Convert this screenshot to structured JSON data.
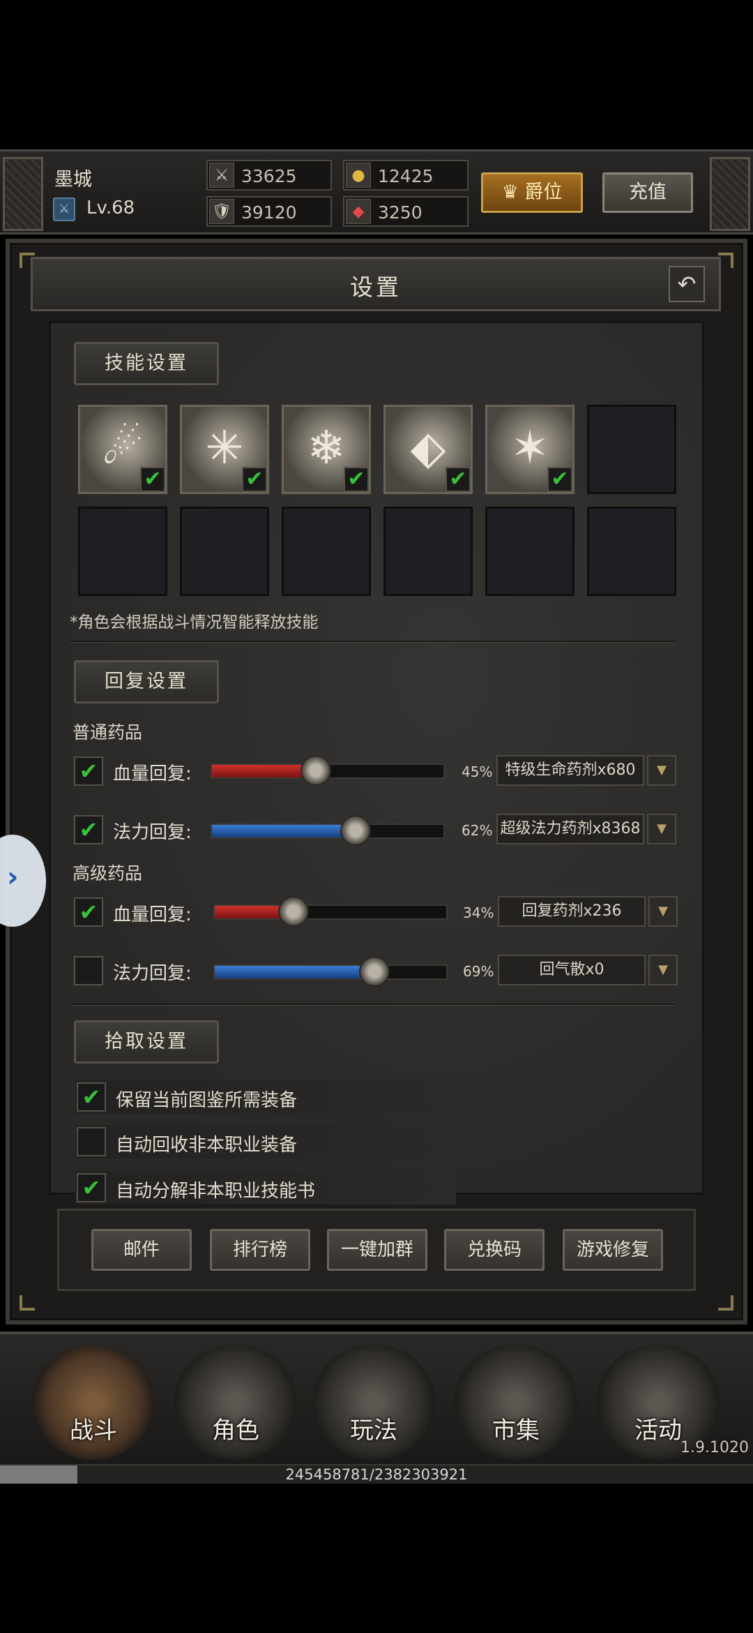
{
  "player": {
    "name": "墨城",
    "level": "Lv.68"
  },
  "stats": {
    "attack": "33625",
    "defense": "39120",
    "gold": "12425",
    "gems": "3250"
  },
  "header_buttons": {
    "rank_label": "爵位",
    "recharge_label": "充值"
  },
  "settings": {
    "title": "设置",
    "skill_section": {
      "label": "技能设置",
      "slots": [
        {
          "icon": "fireball-icon",
          "checked": true
        },
        {
          "icon": "burst-icon",
          "checked": true
        },
        {
          "icon": "frost-shield-icon",
          "checked": true
        },
        {
          "icon": "ice-shard-icon",
          "checked": true
        },
        {
          "icon": "meteor-shower-icon",
          "checked": true
        },
        {
          "icon": "empty-slot",
          "checked": false
        }
      ],
      "note": "*角色会根据战斗情况智能释放技能"
    },
    "recovery_section": {
      "label": "回复设置",
      "normal_title": "普通药品",
      "advanced_title": "高级药品",
      "rows": [
        {
          "label": "血量回复:",
          "checked": true,
          "percent": 45,
          "percent_text": "45%",
          "item": "特级生命药剂x680",
          "color": "#c42a25"
        },
        {
          "label": "法力回复:",
          "checked": true,
          "percent": 62,
          "percent_text": "62%",
          "item": "超级法力药剂x8368",
          "color": "#2f6fc6"
        },
        {
          "label": "血量回复:",
          "checked": true,
          "percent": 34,
          "percent_text": "34%",
          "item": "回复药剂x236",
          "color": "#c42a25"
        },
        {
          "label": "法力回复:",
          "checked": false,
          "percent": 69,
          "percent_text": "69%",
          "item": "回气散x0",
          "color": "#2f6fc6"
        }
      ]
    },
    "pickup_section": {
      "label": "拾取设置",
      "options": [
        {
          "label": "保留当前图鉴所需装备",
          "checked": true
        },
        {
          "label": "自动回收非本职业装备",
          "checked": false
        },
        {
          "label": "自动分解非本职业技能书",
          "checked": true
        }
      ]
    },
    "bottom_buttons": [
      "邮件",
      "排行榜",
      "一键加群",
      "兑换码",
      "游戏修复"
    ]
  },
  "nav": {
    "items": [
      {
        "label": "战斗",
        "active": true
      },
      {
        "label": "角色",
        "active": false
      },
      {
        "label": "玩法",
        "active": false
      },
      {
        "label": "市集",
        "active": false
      },
      {
        "label": "活动",
        "active": false
      }
    ],
    "version": "1.9.1020"
  },
  "experience": {
    "text": "245458781/2382303921",
    "fraction": 0.103
  }
}
